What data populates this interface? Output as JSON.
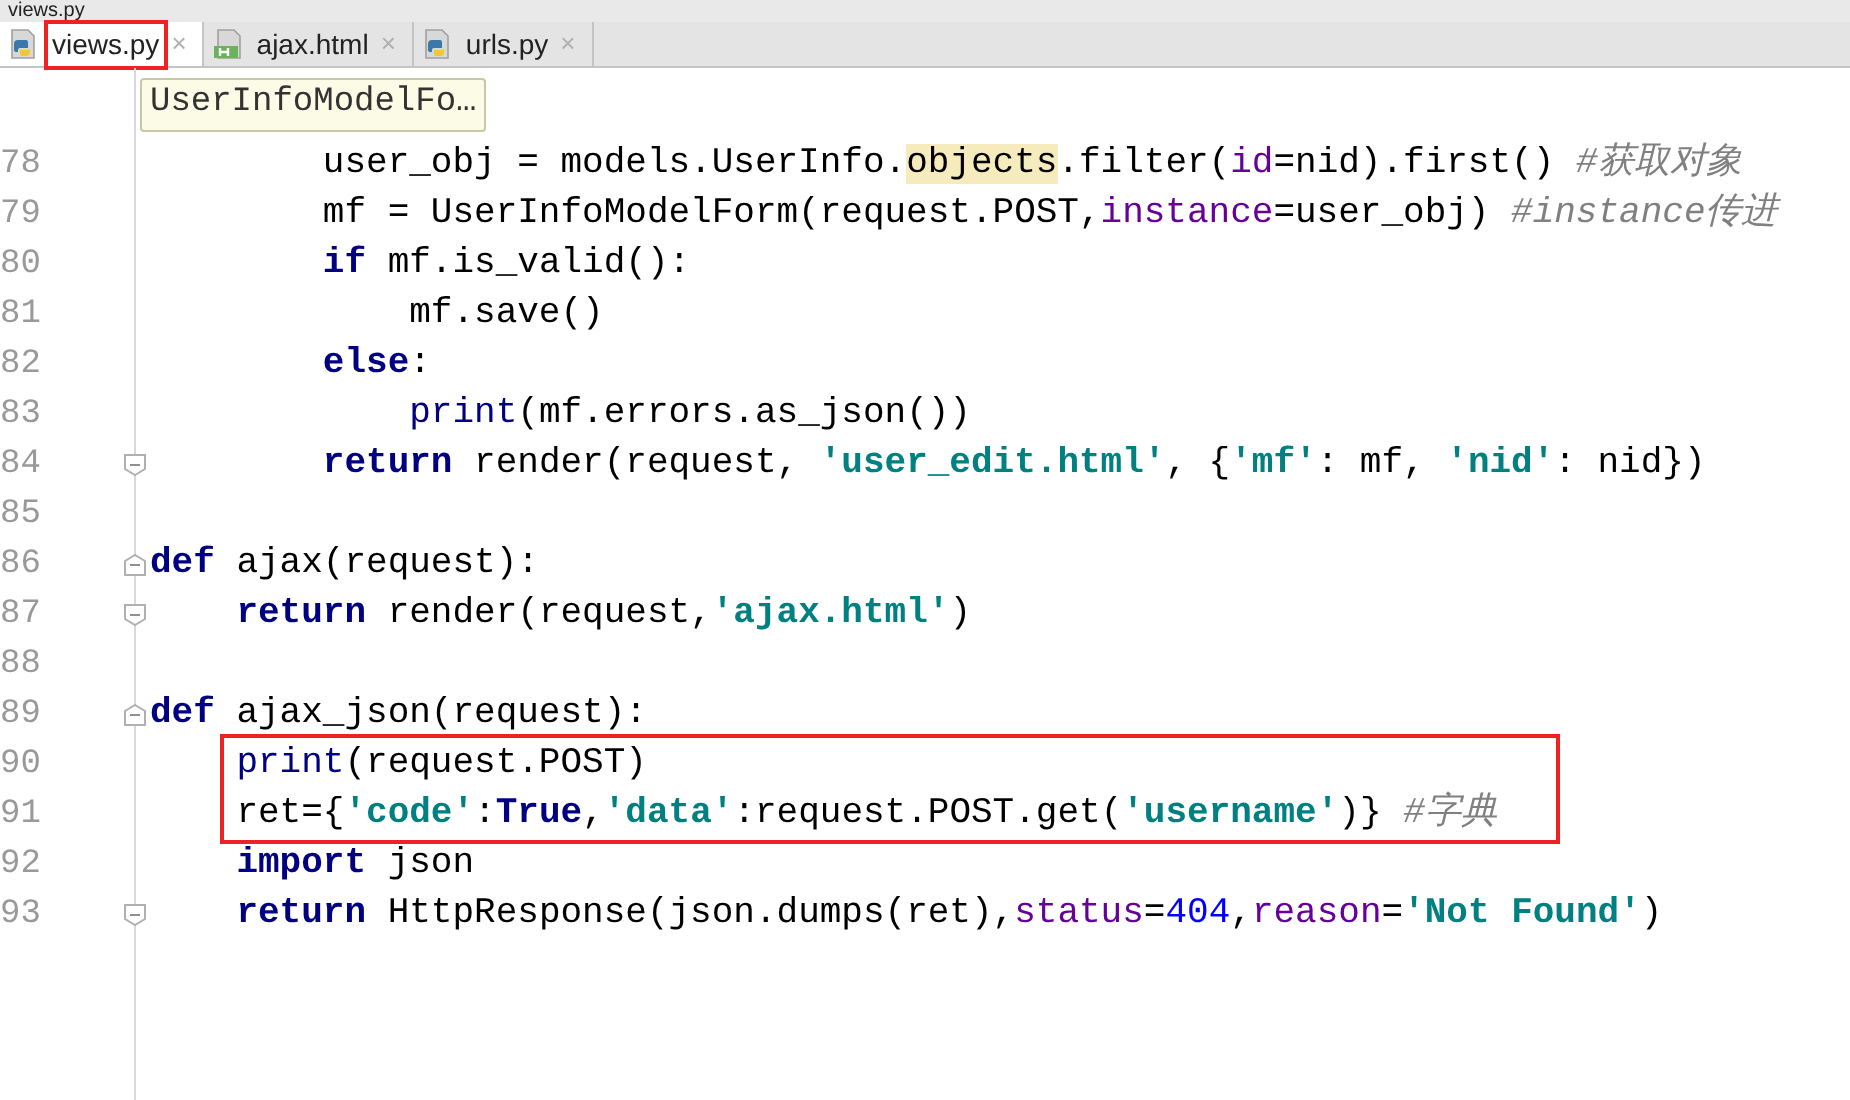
{
  "breadcrumb": "views.py",
  "tabs": [
    {
      "label": "views.py",
      "kind": "python",
      "close": "×",
      "selected": true,
      "marked": true
    },
    {
      "label": "ajax.html",
      "kind": "html",
      "close": "×",
      "selected": false,
      "marked": false
    },
    {
      "label": "urls.py",
      "kind": "python",
      "close": "×",
      "selected": false,
      "marked": false
    }
  ],
  "tooltip": "UserInfoModelFo…",
  "lines": [
    {
      "number": "78",
      "kind": "plain",
      "marked": false,
      "tokens": [
        {
          "kind": "plain",
          "text": "        user_obj = models.UserInfo."
        },
        {
          "kind": "highlight",
          "text": "objects"
        },
        {
          "kind": "plain",
          "text": ".filter("
        },
        {
          "kind": "kwarg",
          "text": "id"
        },
        {
          "kind": "plain",
          "text": "=nid).first() "
        },
        {
          "kind": "comment",
          "text": "#获取对象"
        }
      ]
    },
    {
      "number": "79",
      "kind": "plain",
      "marked": false,
      "tokens": [
        {
          "kind": "plain",
          "text": "        mf = UserInfoModelForm(request.POST,"
        },
        {
          "kind": "kwarg",
          "text": "instance"
        },
        {
          "kind": "plain",
          "text": "=user_obj) "
        },
        {
          "kind": "comment",
          "text": "#instance传进"
        }
      ]
    },
    {
      "number": "80",
      "kind": "plain",
      "marked": false,
      "tokens": [
        {
          "kind": "keyword",
          "text": "        if"
        },
        {
          "kind": "plain",
          "text": " mf.is_valid():"
        }
      ]
    },
    {
      "number": "81",
      "kind": "plain",
      "marked": false,
      "tokens": [
        {
          "kind": "plain",
          "text": "            mf.save()"
        }
      ]
    },
    {
      "number": "82",
      "kind": "plain",
      "marked": false,
      "tokens": [
        {
          "kind": "keyword",
          "text": "        else"
        },
        {
          "kind": "plain",
          "text": ":"
        }
      ]
    },
    {
      "number": "83",
      "kind": "plain",
      "marked": false,
      "tokens": [
        {
          "kind": "builtin",
          "text": "            print"
        },
        {
          "kind": "plain",
          "text": "(mf.errors.as_json())"
        }
      ]
    },
    {
      "number": "84",
      "kind": "fold_end",
      "marked": false,
      "tokens": [
        {
          "kind": "keyword",
          "text": "        return"
        },
        {
          "kind": "plain",
          "text": " render(request, "
        },
        {
          "kind": "string",
          "text": "'user_edit.html'"
        },
        {
          "kind": "plain",
          "text": ", {"
        },
        {
          "kind": "string",
          "text": "'mf'"
        },
        {
          "kind": "plain",
          "text": ": mf, "
        },
        {
          "kind": "string",
          "text": "'nid'"
        },
        {
          "kind": "plain",
          "text": ": nid})"
        }
      ]
    },
    {
      "number": "85",
      "kind": "plain",
      "marked": false
    },
    {
      "number": "86",
      "kind": "fold_start",
      "marked": false,
      "tokens": [
        {
          "kind": "keyword",
          "text": "def"
        },
        {
          "kind": "plain",
          "text": " ajax(request):"
        }
      ]
    },
    {
      "number": "87",
      "kind": "fold_end",
      "marked": false,
      "tokens": [
        {
          "kind": "keyword",
          "text": "    return"
        },
        {
          "kind": "plain",
          "text": " render(request,"
        },
        {
          "kind": "string",
          "text": "'ajax.html'"
        },
        {
          "kind": "plain",
          "text": ")"
        }
      ]
    },
    {
      "number": "88",
      "kind": "plain",
      "marked": false
    },
    {
      "number": "89",
      "kind": "fold_start",
      "marked": false,
      "tokens": [
        {
          "kind": "keyword",
          "text": "def"
        },
        {
          "kind": "plain",
          "text": " ajax_json(request):"
        }
      ]
    },
    {
      "number": "90",
      "kind": "plain",
      "marked": true,
      "tokens": [
        {
          "kind": "builtin",
          "text": "    print"
        },
        {
          "kind": "plain",
          "text": "(request.POST)"
        }
      ]
    },
    {
      "number": "91",
      "kind": "plain",
      "marked": true,
      "tokens": [
        {
          "kind": "plain",
          "text": "    ret={"
        },
        {
          "kind": "string",
          "text": "'code'"
        },
        {
          "kind": "plain",
          "text": ":"
        },
        {
          "kind": "keyword",
          "text": "True"
        },
        {
          "kind": "plain",
          "text": ","
        },
        {
          "kind": "string",
          "text": "'data'"
        },
        {
          "kind": "plain",
          "text": ":request.POST.get("
        },
        {
          "kind": "string",
          "text": "'username'"
        },
        {
          "kind": "plain",
          "text": ")} "
        },
        {
          "kind": "comment",
          "text": "#字典"
        }
      ]
    },
    {
      "number": "92",
      "kind": "plain",
      "marked": false,
      "tokens": [
        {
          "kind": "keyword",
          "text": "    import"
        },
        {
          "kind": "plain",
          "text": " json"
        }
      ]
    },
    {
      "number": "93",
      "kind": "fold_end",
      "marked": false,
      "tokens": [
        {
          "kind": "keyword",
          "text": "    return"
        },
        {
          "kind": "plain",
          "text": " HttpResponse(json.dumps(ret),"
        },
        {
          "kind": "kwarg",
          "text": "status"
        },
        {
          "kind": "plain",
          "text": "="
        },
        {
          "kind": "number",
          "text": "404"
        },
        {
          "kind": "plain",
          "text": ","
        },
        {
          "kind": "kwarg",
          "text": "reason"
        },
        {
          "kind": "plain",
          "text": "="
        },
        {
          "kind": "string",
          "text": "'Not Found'"
        },
        {
          "kind": "plain",
          "text": ")"
        }
      ]
    }
  ]
}
